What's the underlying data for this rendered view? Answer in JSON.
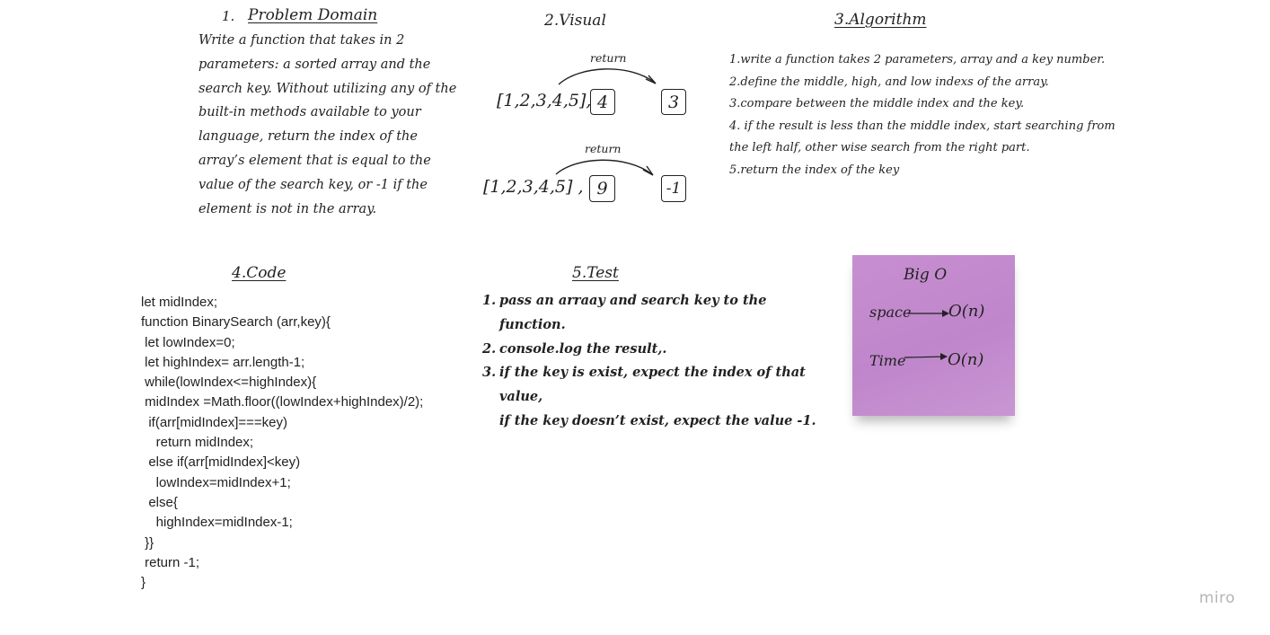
{
  "problem_domain": {
    "number": "1.",
    "title": "Problem Domain",
    "lines": [
      "Write a function that takes in 2",
      "parameters: a sorted array and the",
      "search key. Without utilizing any of the",
      "built-in methods available to your",
      "language, return the index of the",
      "array’s element that is equal to the",
      "value of the search key, or -1 if the",
      "element is not in the array."
    ]
  },
  "visual": {
    "title": "2.Visual",
    "examples": [
      {
        "array": "[1,2,3,4,5],",
        "key": "4",
        "result": "3",
        "label": "return"
      },
      {
        "array": "[1,2,3,4,5] ,",
        "key": "9",
        "result": "-1",
        "label": "return"
      }
    ]
  },
  "algorithm": {
    "title": "3.Algorithm",
    "lines": [
      "1.write a function takes 2 parameters, array and a key number.",
      "2.define the middle, high, and low indexs of the array.",
      "3.compare between the middle index and the key.",
      "4. if the result is less than the middle index, start searching from",
      "the left half,  other wise search from the right part.",
      "5.return the index of the key"
    ]
  },
  "code": {
    "title": "4.Code",
    "lines": [
      "let midIndex;",
      "function BinarySearch (arr,key){",
      " let lowIndex=0;",
      " let highIndex= arr.length-1;",
      " while(lowIndex<=highIndex){",
      " midIndex =Math.floor((lowIndex+highIndex)/2);",
      "  if(arr[midIndex]===key)",
      "    return midIndex;",
      "  else if(arr[midIndex]<key)",
      "    lowIndex=midIndex+1;",
      "  else{",
      "    highIndex=midIndex-1;",
      " }}",
      " return -1;",
      "}"
    ]
  },
  "test": {
    "title": "5.Test",
    "items": [
      {
        "num": "1.",
        "text": "pass an arraay and search key to the"
      },
      {
        "num": "",
        "text": "function."
      },
      {
        "num": "2.",
        "text": "console.log the result,."
      },
      {
        "num": "3.",
        "text": "if the key is exist, expect  the index of that"
      },
      {
        "num": "",
        "text": "value,"
      },
      {
        "num": "",
        "text": "if the key doesn’t exist, expect the value -1."
      }
    ]
  },
  "big_o": {
    "title": "Big O",
    "space_label": "space",
    "space_value": "O(n)",
    "time_label": "Time",
    "time_value": "O(n)",
    "note_color": "#c48ccf"
  },
  "brand": {
    "logo": "miro"
  }
}
